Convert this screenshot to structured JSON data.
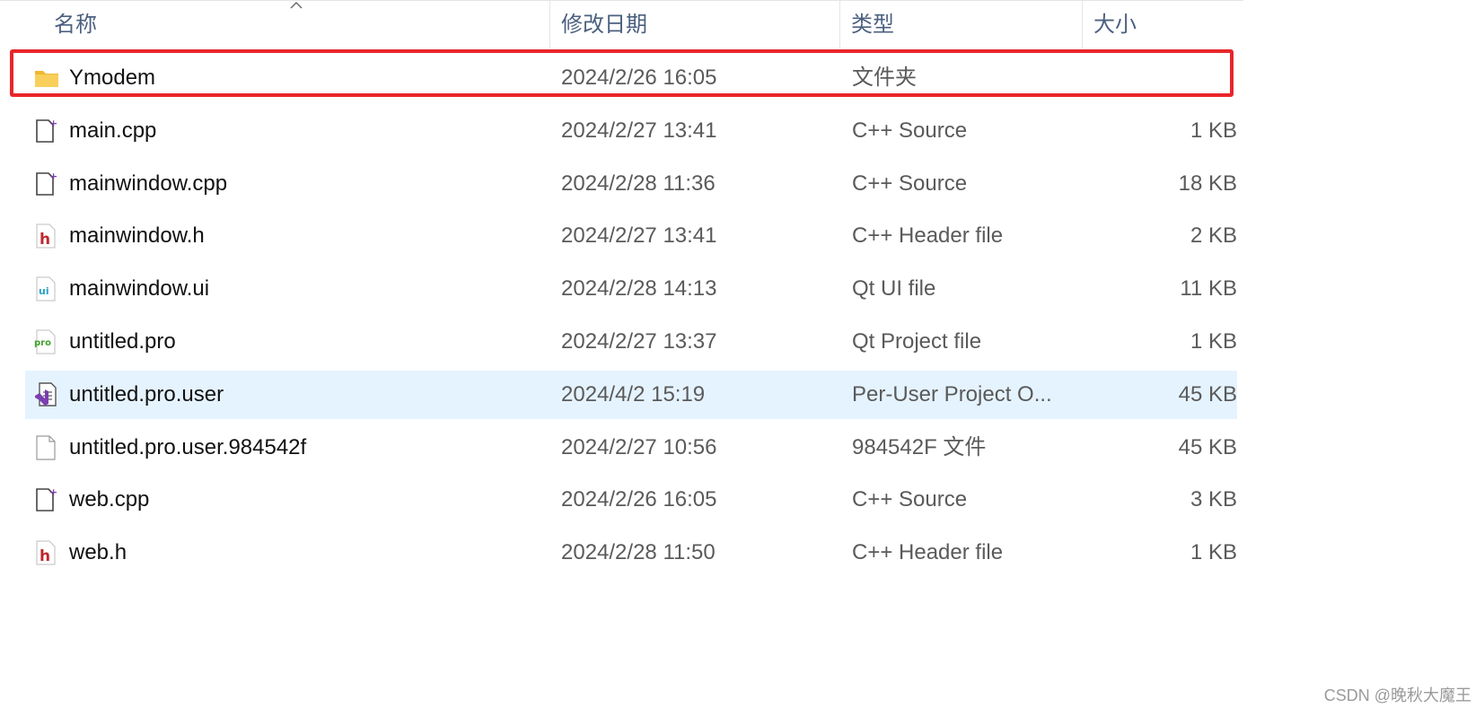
{
  "columns": {
    "name": "名称",
    "date": "修改日期",
    "type": "类型",
    "size": "大小"
  },
  "files": [
    {
      "name": "Ymodem",
      "date": "2024/2/26 16:05",
      "type": "文件夹",
      "size": "",
      "icon": "folder-icon",
      "highlighted": true
    },
    {
      "name": "main.cpp",
      "date": "2024/2/27 13:41",
      "type": "C++ Source",
      "size": "1 KB",
      "icon": "cpp-file-icon"
    },
    {
      "name": "mainwindow.cpp",
      "date": "2024/2/28 11:36",
      "type": "C++ Source",
      "size": "18 KB",
      "icon": "cpp-file-icon"
    },
    {
      "name": "mainwindow.h",
      "date": "2024/2/27 13:41",
      "type": "C++ Header file",
      "size": "2 KB",
      "icon": "header-file-icon"
    },
    {
      "name": "mainwindow.ui",
      "date": "2024/2/28 14:13",
      "type": "Qt UI file",
      "size": "11 KB",
      "icon": "qt-ui-file-icon"
    },
    {
      "name": "untitled.pro",
      "date": "2024/2/27 13:37",
      "type": "Qt Project file",
      "size": "1 KB",
      "icon": "qt-pro-file-icon"
    },
    {
      "name": "untitled.pro.user",
      "date": "2024/4/2 15:19",
      "type": "Per-User Project O...",
      "size": "45 KB",
      "icon": "visual-studio-file-icon",
      "selected": true
    },
    {
      "name": "untitled.pro.user.984542f",
      "date": "2024/2/27 10:56",
      "type": "984542F 文件",
      "size": "45 KB",
      "icon": "blank-file-icon"
    },
    {
      "name": "web.cpp",
      "date": "2024/2/26 16:05",
      "type": "C++ Source",
      "size": "3 KB",
      "icon": "cpp-file-icon"
    },
    {
      "name": "web.h",
      "date": "2024/2/28 11:50",
      "type": "C++ Header file",
      "size": "1 KB",
      "icon": "header-file-icon"
    }
  ],
  "colors": {
    "header_text": "#4c607f",
    "selection": "#e5f3ff",
    "highlight_border": "#e8262b",
    "folder": "#f8c74a"
  },
  "watermark": "CSDN @晚秋大魔王"
}
